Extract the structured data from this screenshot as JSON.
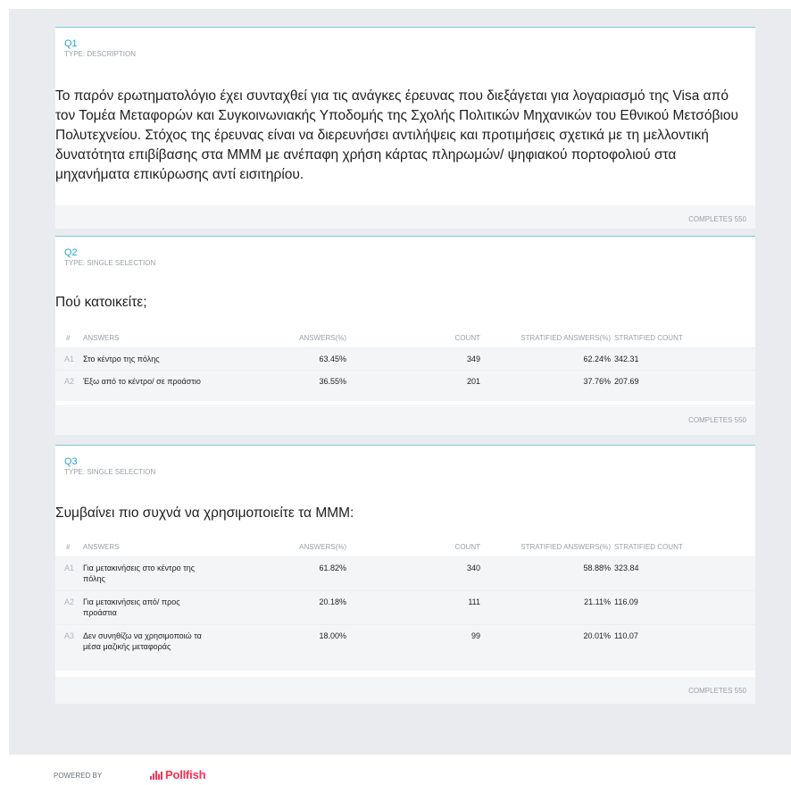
{
  "questions": {
    "q1": {
      "number": "Q1",
      "type": "TYPE: DESCRIPTION",
      "text": "Το παρόν ερωτηματολόγιο έχει συνταχθεί για τις ανάγκες έρευνας που διεξάγεται για λογαριασμό της Visa από τον Τομέα Μεταφορών και Συγκοινωνιακής Υποδομής της Σχολής Πολιτικών Μηχανικών του Εθνικού Μετσόβιου Πολυτεχνείου. Στόχος της έρευνας είναι να διερευνήσει αντιλήψεις και προτιμήσεις σχετικά με τη μελλοντική δυνατότητα επιβίβασης στα ΜΜΜ με ανέπαφη χρήση κάρτας πληρωμών/ ψηφιακού πορτοφολιού στα μηχανήματα επικύρωσης αντί εισιτηρίου.",
      "completes": "COMPLETES 550"
    },
    "q2": {
      "number": "Q2",
      "type": "TYPE: SINGLE SELECTION",
      "text": "Πού κατοικείτε;",
      "headers": [
        "#",
        "ANSWERS",
        "ANSWERS(%)",
        "COUNT",
        "STRATIFIED ANSWERS(%)",
        "STRATIFIED COUNT"
      ],
      "rows": [
        {
          "idx": "A1",
          "answer": "Στο κέντρο της πόλης",
          "pct": "63.45%",
          "count": "349",
          "spct": "62.24%",
          "scount": "342.31"
        },
        {
          "idx": "A2",
          "answer": "Έξω από το κέντρο/ σε προάστιο",
          "pct": "36.55%",
          "count": "201",
          "spct": "37.76%",
          "scount": "207.69"
        }
      ],
      "completes": "COMPLETES 550"
    },
    "q3": {
      "number": "Q3",
      "type": "TYPE: SINGLE SELECTION",
      "text": "Συμβαίνει πιο συχνά να χρησιμοποιείτε τα ΜΜΜ:",
      "headers": [
        "#",
        "ANSWERS",
        "ANSWERS(%)",
        "COUNT",
        "STRATIFIED ANSWERS(%)",
        "STRATIFIED COUNT"
      ],
      "rows": [
        {
          "idx": "A1",
          "answer": "Για μετακινήσεις στο κέντρο της πόλης",
          "pct": "61.82%",
          "count": "340",
          "spct": "58.88%",
          "scount": "323.84"
        },
        {
          "idx": "A2",
          "answer": "Για μετακινήσεις από/ προς προάστια",
          "pct": "20.18%",
          "count": "111",
          "spct": "21.11%",
          "scount": "116.09"
        },
        {
          "idx": "A3",
          "answer": "Δεν συνηθίζω να χρησιμοποιώ τα μέσα μαζικής μεταφοράς",
          "pct": "18.00%",
          "count": "99",
          "spct": "20.01%",
          "scount": "110.07"
        }
      ],
      "completes": "COMPLETES 550"
    }
  },
  "footer": {
    "powered_by": "POWERED BY",
    "brand": "Pollfish",
    "brand_color": "#ff2d52",
    "brand_icon": "pollfish-logo-icon"
  },
  "colors": {
    "accent": "#27a3d4",
    "background": "#e9ebee"
  }
}
